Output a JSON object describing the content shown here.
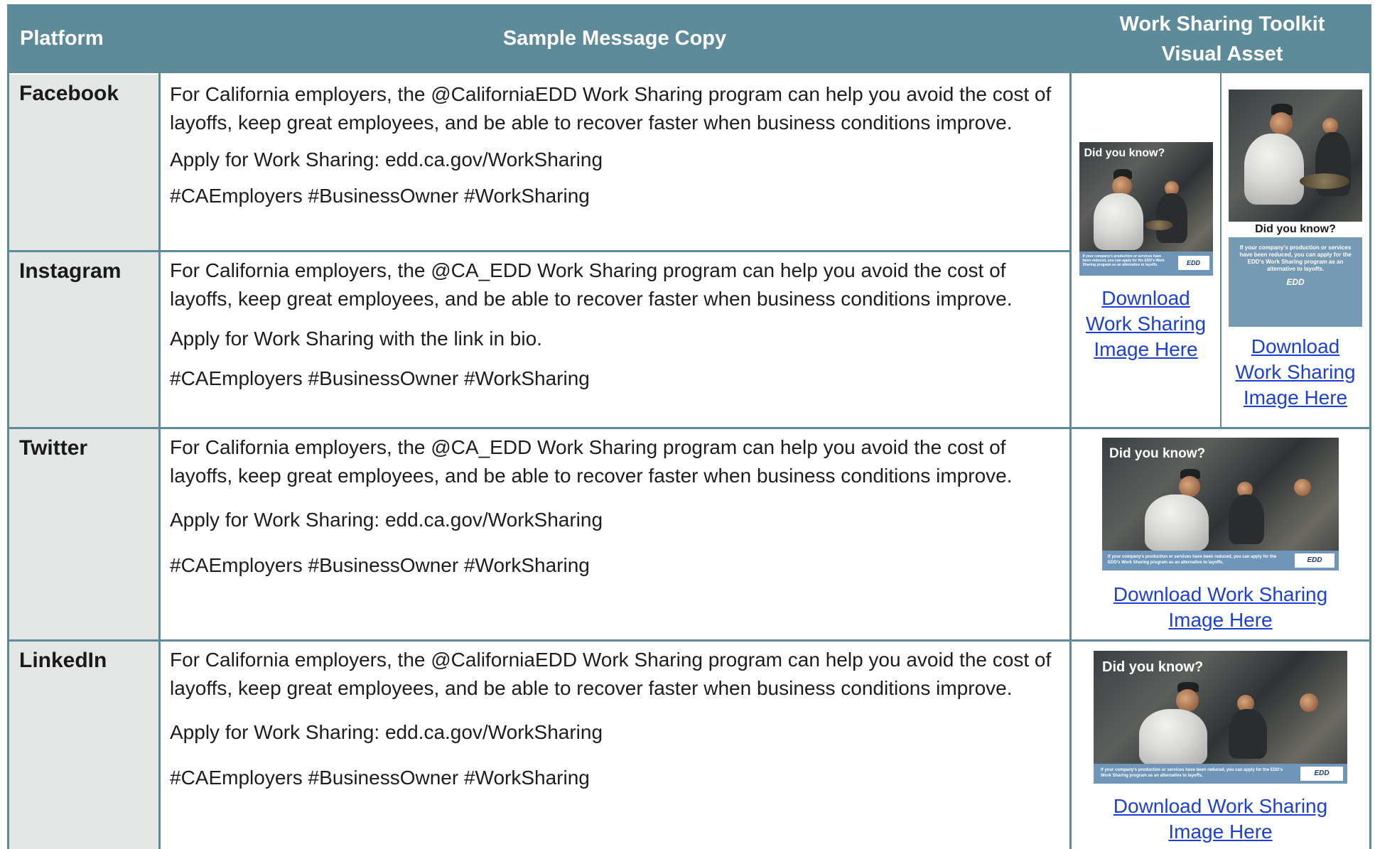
{
  "header": {
    "platform": "Platform",
    "copy": "Sample Message Copy",
    "asset_line1": "Work Sharing Toolkit",
    "asset_line2": "Visual Asset"
  },
  "rows": [
    {
      "platform": "Facebook",
      "para1": "For California employers, the @CaliforniaEDD Work Sharing program can help you avoid the cost of layoffs, keep great employees, and be able to recover faster when business conditions improve.",
      "para2": "Apply for Work Sharing: edd.ca.gov/WorkSharing",
      "para3": "#CAEmployers #BusinessOwner #WorkSharing"
    },
    {
      "platform": "Instagram",
      "para1": "For California employers, the @CA_EDD Work Sharing program can help you avoid the cost of layoffs, keep great employees, and be able to recover faster when business conditions improve.",
      "para2": "Apply for Work Sharing with the link in bio.",
      "para3": "#CAEmployers #BusinessOwner #WorkSharing"
    },
    {
      "platform": "Twitter",
      "para1": "For California employers, the @CA_EDD Work Sharing program can help you avoid the cost of layoffs, keep great employees, and be able to recover faster when business conditions improve.",
      "para2": "Apply for Work Sharing: edd.ca.gov/WorkSharing",
      "para3": "#CAEmployers #BusinessOwner #WorkSharing"
    },
    {
      "platform": "LinkedIn",
      "para1": "For California employers, the @CaliforniaEDD Work Sharing program can help you avoid the cost of layoffs, keep great employees, and be able to recover faster when business conditions improve.",
      "para2": "Apply for Work Sharing: edd.ca.gov/WorkSharing",
      "para3": "#CAEmployers #BusinessOwner #WorkSharing"
    }
  ],
  "assets": {
    "image_heading": "Did you know?",
    "image_caption_wide": "If your company's production or services have been reduced, you can apply for the EDD's Work Sharing program as an alternative to layoffs.",
    "image_caption_tall": "If your company's production or services have been reduced, you can apply for the EDD's Work Sharing program as an alternative to layoffs.",
    "logo_text": "EDD",
    "link_square_1": "Download",
    "link_square_2": "Work Sharing",
    "link_square_3": "Image Here",
    "link_wide_1": "Download Work Sharing",
    "link_wide_2": "Image Here"
  },
  "colors": {
    "header_bg": "#5e8b9a",
    "platform_bg": "#e4e6e6",
    "link": "#1c3fd6",
    "image_band": "#6f95b8"
  }
}
